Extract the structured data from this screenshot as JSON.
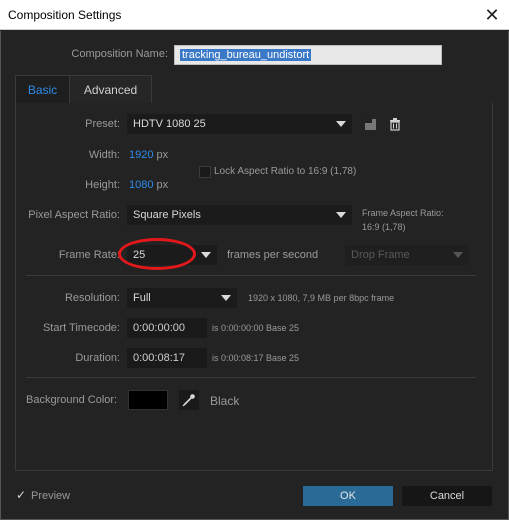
{
  "window": {
    "title": "Composition Settings"
  },
  "composition": {
    "name_label": "Composition Name:",
    "name_value": "tracking_bureau_undistort"
  },
  "tabs": [
    {
      "label": "Basic"
    },
    {
      "label": "Advanced"
    }
  ],
  "preset": {
    "label": "Preset:",
    "value": "HDTV 1080 25"
  },
  "width": {
    "label": "Width:",
    "value": "1920",
    "unit": "px"
  },
  "height": {
    "label": "Height:",
    "value": "1080",
    "unit": "px"
  },
  "lock_aspect": {
    "label": "Lock Aspect Ratio to 16:9 (1,78)",
    "checked": false
  },
  "pixel_aspect": {
    "label": "Pixel Aspect Ratio:",
    "value": "Square Pixels"
  },
  "frame_aspect": {
    "label": "Frame Aspect Ratio:",
    "value": "16:9 (1,78)"
  },
  "frame_rate": {
    "label": "Frame Rate:",
    "value": "25",
    "unit": "frames per second",
    "drop_frame": "Drop Frame"
  },
  "resolution": {
    "label": "Resolution:",
    "value": "Full",
    "info": "1920 x 1080, 7,9 MB per 8bpc frame"
  },
  "start_timecode": {
    "label": "Start Timecode:",
    "value": "0:00:00:00",
    "info": "is 0:00:00:00  Base 25"
  },
  "duration": {
    "label": "Duration:",
    "value": "0:00:08:17",
    "info": "is 0:00:08:17  Base 25"
  },
  "background": {
    "label": "Background Color:",
    "color": "#000000",
    "name": "Black"
  },
  "footer": {
    "preview_label": "Preview",
    "preview_checked": true,
    "ok_label": "OK",
    "cancel_label": "Cancel"
  },
  "colors": {
    "accent": "#2d8ceb",
    "ok_button": "#2a6a96",
    "annotation_circle": "#e3181b",
    "dialog_bg": "#232323"
  }
}
